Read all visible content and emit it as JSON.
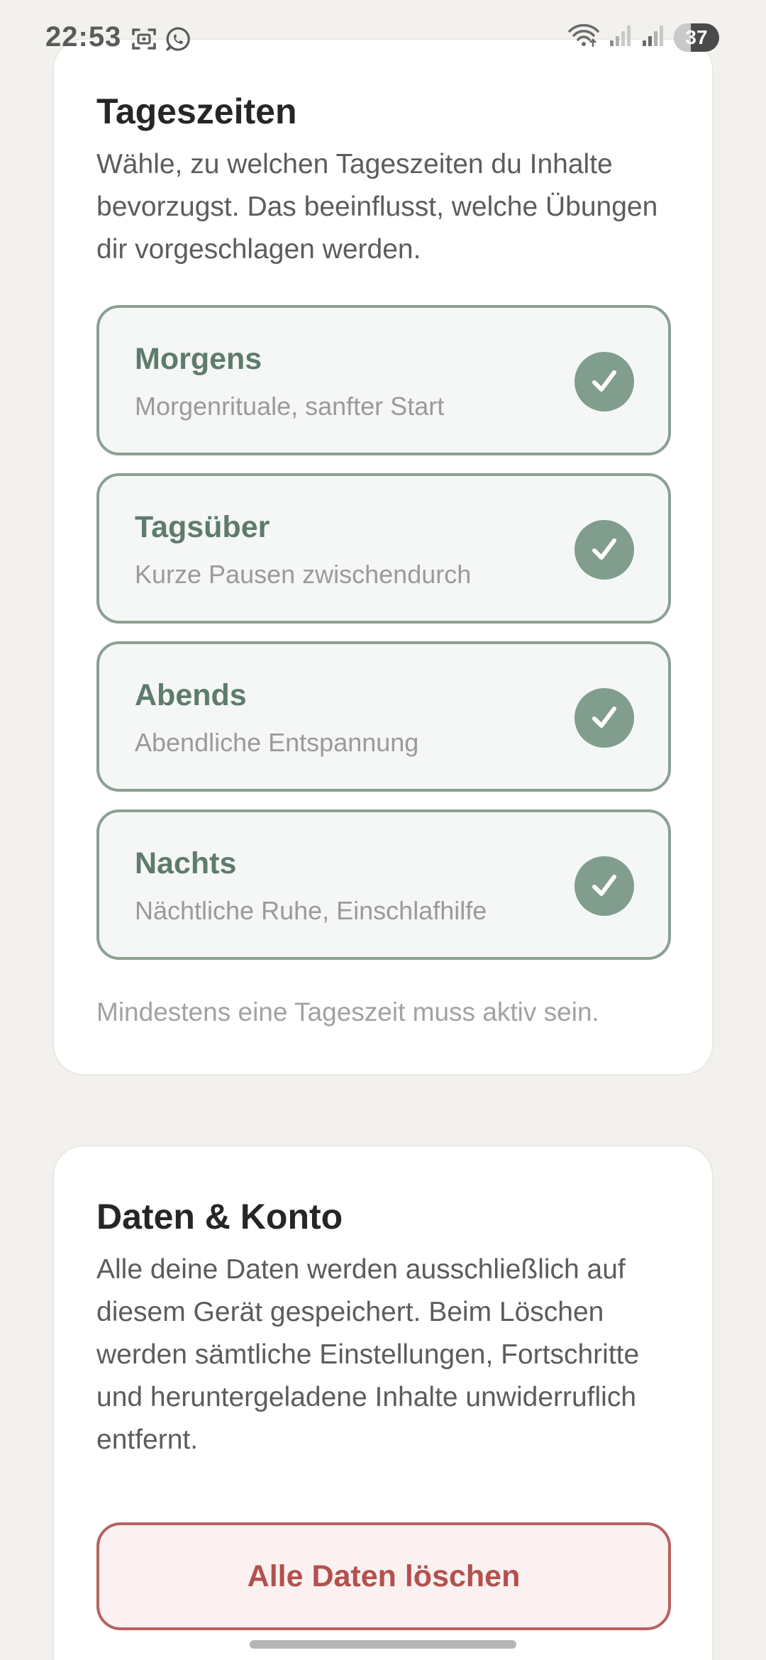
{
  "status_bar": {
    "time": "22:53",
    "notification_icons": [
      "screenshot-icon",
      "whatsapp-icon"
    ],
    "system_icons": [
      "wifi-icon",
      "signal-icon",
      "signal-icon"
    ],
    "battery": "37",
    "battery_level": 0.37
  },
  "tageszeiten": {
    "title": "Tageszeiten",
    "description": "Wähle, zu welchen Tageszeiten du Inhalte bevorzugst. Das beeinflusst, welche Übungen dir vorgeschlagen werden.",
    "options": [
      {
        "title": "Morgens",
        "subtitle": "Morgenrituale, sanfter Start",
        "checked": true
      },
      {
        "title": "Tagsüber",
        "subtitle": "Kurze Pausen zwischendurch",
        "checked": true
      },
      {
        "title": "Abends",
        "subtitle": "Abendliche Entspannung",
        "checked": true
      },
      {
        "title": "Nachts",
        "subtitle": "Nächtliche Ruhe, Einschlafhilfe",
        "checked": true
      }
    ],
    "hint": "Mindestens eine Tageszeit muss aktiv sein."
  },
  "daten_konto": {
    "title": "Daten & Konto",
    "description": "Alle deine Daten werden ausschließlich auf diesem Gerät gespeichert. Beim Löschen werden sämtliche Einstellungen, Fortschritte und heruntergeladene Inhalte unwiderruflich entfernt.",
    "delete_button": "Alle Daten löschen"
  },
  "colors": {
    "accent": "#819d8d",
    "accent_text": "#5e7b6c",
    "danger": "#b2514e",
    "background": "#f3f1ee"
  }
}
